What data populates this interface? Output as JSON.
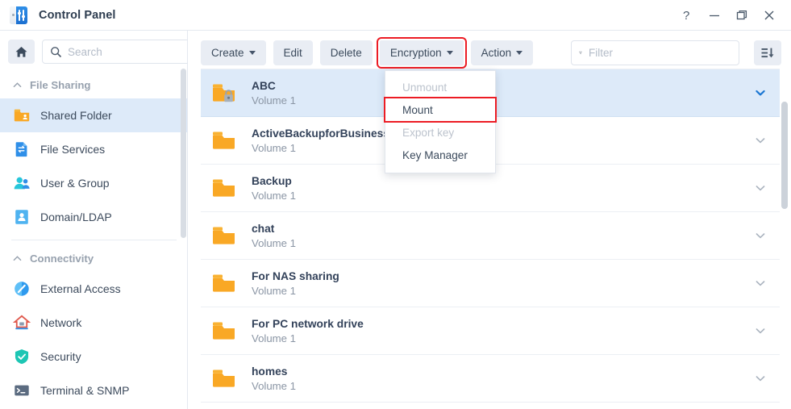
{
  "window": {
    "title": "Control Panel",
    "app_icon": "control-panel-icon",
    "controls": {
      "help": "?",
      "minimize": "minimize",
      "maximize": "maximize",
      "close": "close"
    }
  },
  "sidebar": {
    "home_button": "home-icon",
    "search": {
      "value": "",
      "placeholder": "Search"
    },
    "groups": [
      {
        "label": "File Sharing",
        "collapse_icon": "chevron-up-icon",
        "items": [
          {
            "label": "Shared Folder",
            "icon": "shared-folder-icon",
            "active": true
          },
          {
            "label": "File Services",
            "icon": "file-services-icon",
            "active": false
          },
          {
            "label": "User & Group",
            "icon": "user-group-icon",
            "active": false
          },
          {
            "label": "Domain/LDAP",
            "icon": "domain-ldap-icon",
            "active": false
          }
        ]
      },
      {
        "label": "Connectivity",
        "collapse_icon": "chevron-up-icon",
        "items": [
          {
            "label": "External Access",
            "icon": "external-access-icon",
            "active": false
          },
          {
            "label": "Network",
            "icon": "network-icon",
            "active": false
          },
          {
            "label": "Security",
            "icon": "security-shield-icon",
            "active": false
          },
          {
            "label": "Terminal & SNMP",
            "icon": "terminal-snmp-icon",
            "active": false
          }
        ]
      }
    ]
  },
  "toolbar": {
    "create": "Create",
    "edit": "Edit",
    "delete": "Delete",
    "encryption": "Encryption",
    "action": "Action",
    "filter": {
      "value": "",
      "placeholder": "Filter"
    },
    "sort_button": "sort-icon"
  },
  "encryption_menu": {
    "open": true,
    "items": [
      {
        "label": "Unmount",
        "disabled": true,
        "highlighted": false
      },
      {
        "label": "Mount",
        "disabled": false,
        "highlighted": true
      },
      {
        "label": "Export key",
        "disabled": true,
        "highlighted": false
      },
      {
        "label": "Key Manager",
        "disabled": false,
        "highlighted": false
      }
    ]
  },
  "shared_folders": {
    "rows": [
      {
        "name": "ABC",
        "volume": "Volume 1",
        "encrypted": true,
        "selected": true
      },
      {
        "name": "ActiveBackupforBusiness",
        "volume": "Volume 1",
        "encrypted": false,
        "selected": false
      },
      {
        "name": "Backup",
        "volume": "Volume 1",
        "encrypted": false,
        "selected": false
      },
      {
        "name": "chat",
        "volume": "Volume 1",
        "encrypted": false,
        "selected": false
      },
      {
        "name": "For NAS sharing",
        "volume": "Volume 1",
        "encrypted": false,
        "selected": false
      },
      {
        "name": "For PC network drive",
        "volume": "Volume 1",
        "encrypted": false,
        "selected": false
      },
      {
        "name": "homes",
        "volume": "Volume 1",
        "encrypted": false,
        "selected": false
      }
    ]
  },
  "colors": {
    "accent_blue": "#2f8fe8",
    "selected_row": "#ddeaf9",
    "folder_orange": "#f9a825",
    "highlight_red": "#ec1c24",
    "toolbar_button": "#e9edf4",
    "text_primary": "#33425a",
    "text_muted": "#8b96a5"
  }
}
